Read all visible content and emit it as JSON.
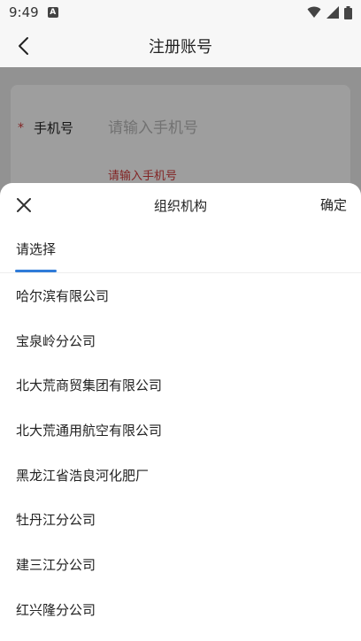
{
  "status_bar": {
    "time": "9:49",
    "notification_letter": "A"
  },
  "nav": {
    "title": "注册账号"
  },
  "form": {
    "phone_label": "手机号",
    "phone_placeholder": "请输入手机号",
    "phone_error": "请输入手机号",
    "required_mark": "*"
  },
  "sheet": {
    "title": "组织机构",
    "confirm_label": "确定",
    "tab_label": "请选择",
    "options": [
      "哈尔滨有限公司",
      "宝泉岭分公司",
      "北大荒商贸集团有限公司",
      "北大荒通用航空有限公司",
      "黑龙江省浩良河化肥厂",
      "牡丹江分公司",
      "建三江分公司",
      "红兴隆分公司"
    ]
  },
  "colors": {
    "accent": "#2f7bd8",
    "error": "#d23b3b"
  }
}
